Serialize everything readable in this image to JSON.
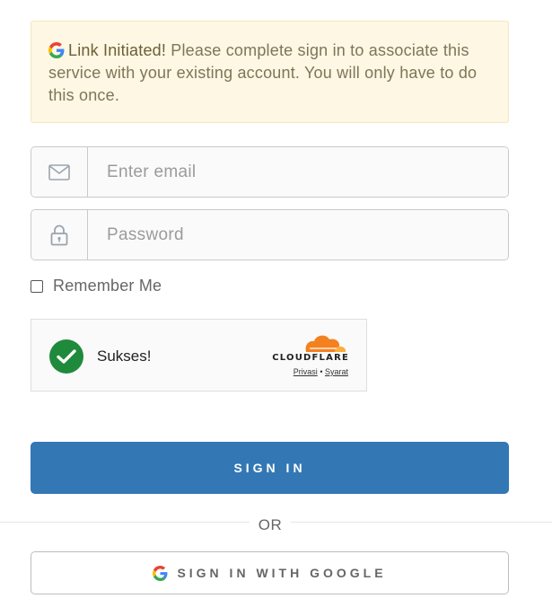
{
  "alert": {
    "title": "Link Initiated!",
    "message": " Please complete sign in to associate this service with your existing account. You will only have to do this once.",
    "icon": "google-g-icon"
  },
  "email": {
    "placeholder": "Enter email",
    "value": "",
    "icon": "envelope-icon"
  },
  "password": {
    "placeholder": "Password",
    "value": "",
    "icon": "lock-icon"
  },
  "remember": {
    "label": "Remember Me",
    "checked": false
  },
  "captcha": {
    "status": "Sukses!",
    "brand": "CLOUDFLARE",
    "privacy": "Privasi",
    "separator": "•",
    "terms": "Syarat",
    "success_color": "#1f8a3b",
    "brand_color": "#f48120"
  },
  "signin": {
    "label": "SIGN IN",
    "color": "#3377b5"
  },
  "divider": {
    "label": "OR"
  },
  "google": {
    "label": "SIGN IN WITH GOOGLE",
    "icon": "google-g-icon"
  }
}
